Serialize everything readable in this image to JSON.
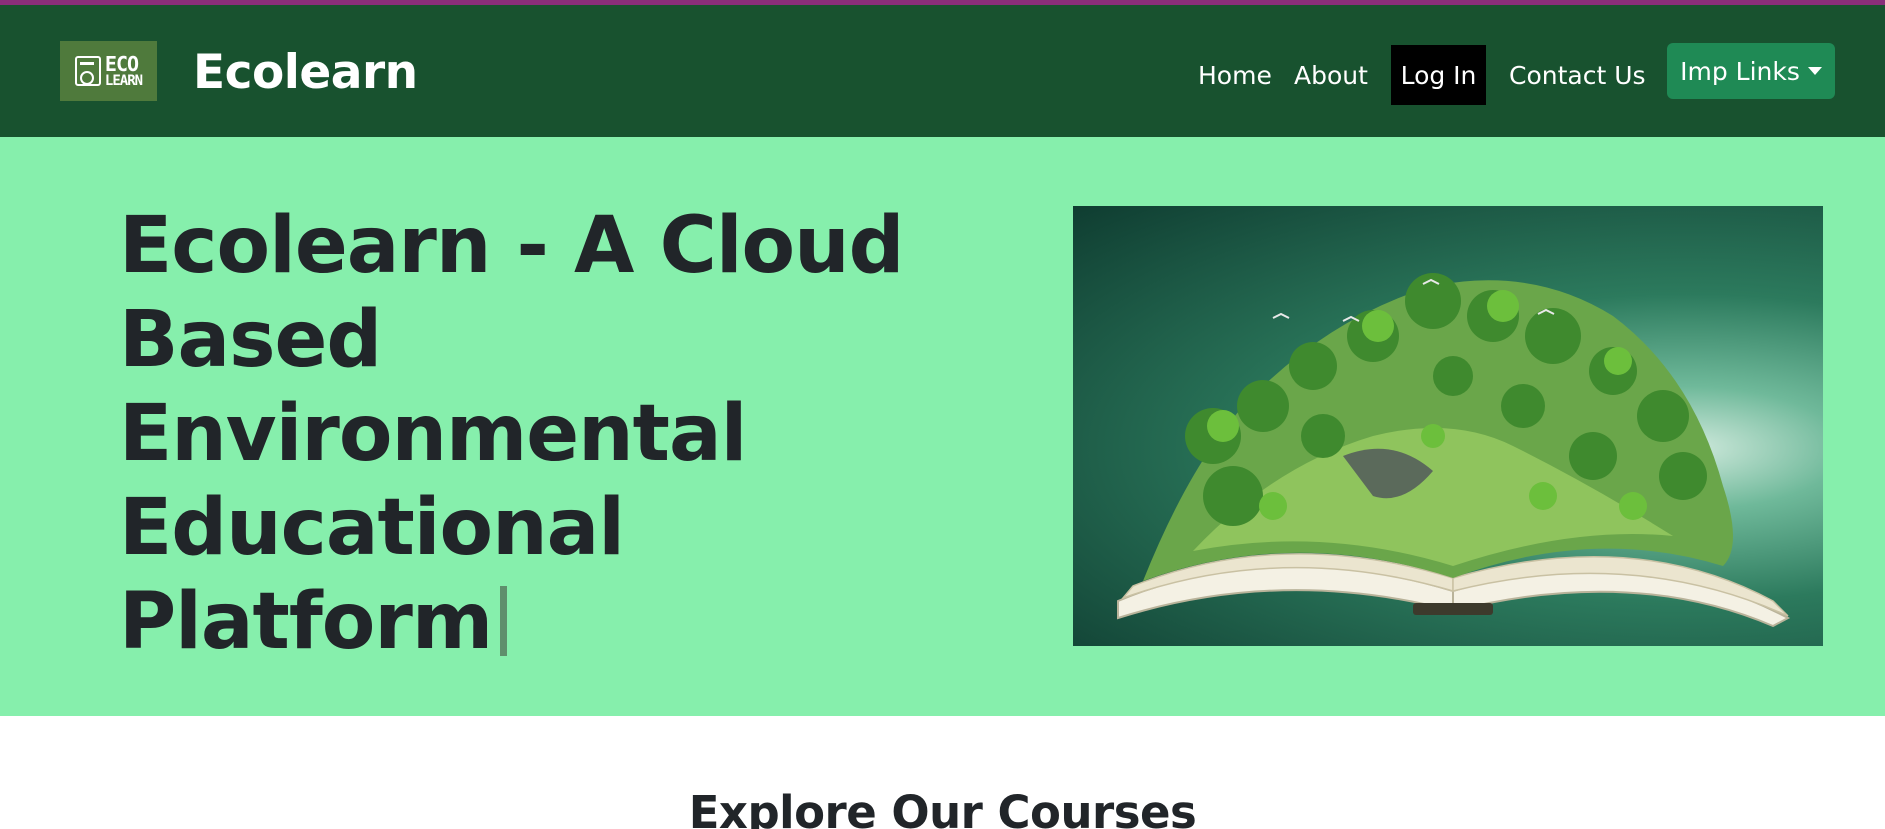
{
  "brand": {
    "logo_line1": "ECO",
    "logo_line2": "LEARN",
    "name": "Ecolearn"
  },
  "nav": {
    "home": "Home",
    "about": "About",
    "login": "Log In",
    "contact": "Contact Us",
    "imp_links": "Imp Links"
  },
  "hero": {
    "title": "Ecolearn - A Cloud Based Environmental Educational Platform"
  },
  "courses": {
    "title": "Explore Our Courses"
  },
  "colors": {
    "navbar": "#18522f",
    "hero_bg": "#86efac",
    "imp_button": "#1f8a55",
    "login_bg": "#000000",
    "accent_bar": "#8a2e7a"
  }
}
